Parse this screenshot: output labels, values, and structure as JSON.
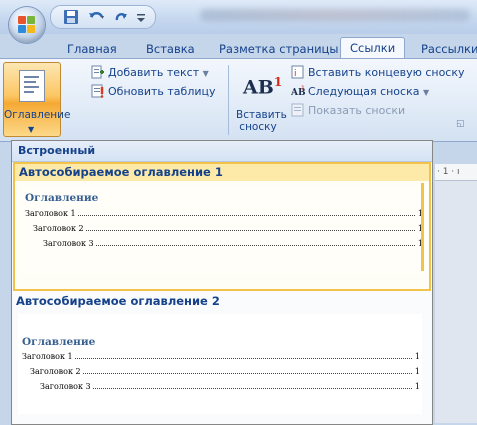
{
  "tabs": [
    {
      "label": "Главная"
    },
    {
      "label": "Вставка"
    },
    {
      "label": "Разметка страницы"
    },
    {
      "label": "Ссылки",
      "active": true
    },
    {
      "label": "Рассылки"
    }
  ],
  "ribbon": {
    "toc_button": {
      "label": "Оглавление"
    },
    "add_text": "Добавить текст",
    "update_table": "Обновить таблицу",
    "insert_footnote_icon_text": "AB",
    "insert_footnote_sup": "1",
    "insert_footnote_label_line1": "Вставить",
    "insert_footnote_label_line2": "сноску",
    "insert_endnote": "Вставить концевую сноску",
    "next_footnote": "Следующая сноска",
    "show_notes": "Показать сноски"
  },
  "ruler": {
    "marks": "· 1 · ı"
  },
  "dropdown": {
    "header": "Встроенный",
    "items": [
      {
        "title": "Автособираемое оглавление 1",
        "preview_title": "Оглавление",
        "rows": [
          {
            "label": "Заголовок 1",
            "page": "1"
          },
          {
            "label": "Заголовок 2",
            "page": "1"
          },
          {
            "label": "Заголовок 3",
            "page": "1"
          }
        ]
      },
      {
        "title": "Автособираемое оглавление 2",
        "preview_title": "Оглавление",
        "rows": [
          {
            "label": "Заголовок 1",
            "page": "1"
          },
          {
            "label": "Заголовок 2",
            "page": "1"
          },
          {
            "label": "Заголовок 3",
            "page": "1"
          }
        ]
      }
    ]
  },
  "colors": {
    "ribbon_text": "#15428b",
    "selected_border": "#f3c249",
    "preview_heading": "#365f91"
  },
  "icons": [
    "office-logo-icon",
    "save-icon",
    "undo-icon",
    "redo-icon",
    "customize-icon",
    "document-icon",
    "add-text-icon",
    "update-table-icon",
    "insert-endnote-icon",
    "next-footnote-icon",
    "show-notes-icon",
    "dialog-launcher-icon"
  ]
}
